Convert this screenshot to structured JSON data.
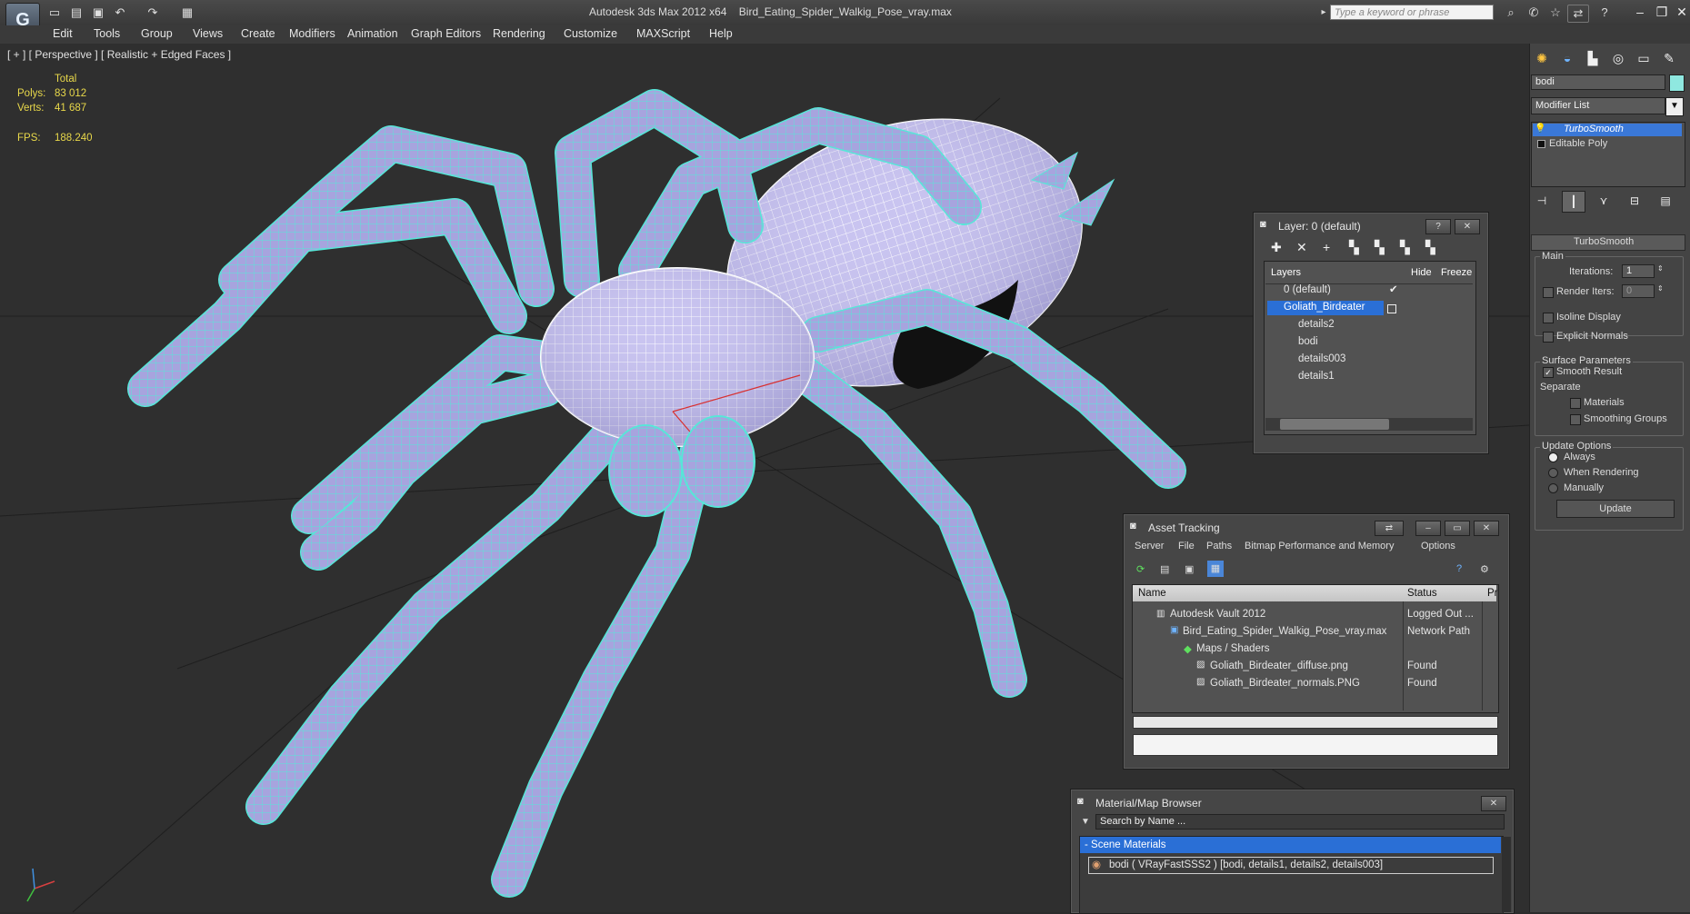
{
  "title": {
    "app": "Autodesk 3ds Max  2012 x64",
    "file": "Bird_Eating_Spider_Walkig_Pose_vray.max",
    "search_placeholder": "Type a keyword or phrase"
  },
  "menu": [
    "Edit",
    "Tools",
    "Group",
    "Views",
    "Create",
    "Modifiers",
    "Animation",
    "Graph Editors",
    "Rendering",
    "Customize",
    "MAXScript",
    "Help"
  ],
  "viewport": {
    "label": "[ + ] [ Perspective ] [ Realistic + Edged Faces ]",
    "stats": {
      "total_label": "Total",
      "polys_label": "Polys:",
      "polys_value": "83 012",
      "verts_label": "Verts:",
      "verts_value": "41 687",
      "fps_label": "FPS:",
      "fps_value": "188.240"
    }
  },
  "command_panel": {
    "object_name": "bodi",
    "modifier_list": "Modifier List",
    "stack": [
      "TurboSmooth",
      "Editable Poly"
    ],
    "rollout_title": "TurboSmooth",
    "main_group": "Main",
    "iterations_label": "Iterations:",
    "iterations_value": "1",
    "render_iters_label": "Render Iters:",
    "render_iters_value": "0",
    "isoline": "Isoline Display",
    "explicit_normals": "Explicit Normals",
    "surface_group": "Surface Parameters",
    "smooth_result": "Smooth Result",
    "separate": "Separate",
    "materials": "Materials",
    "smoothing_groups": "Smoothing Groups",
    "update_group": "Update Options",
    "always": "Always",
    "when_rendering": "When Rendering",
    "manually": "Manually",
    "update_button": "Update"
  },
  "layer_dialog": {
    "title": "Layer: 0 (default)",
    "columns": [
      "Layers",
      "Hide",
      "Freeze"
    ],
    "rows": [
      "0 (default)",
      "Goliath_Birdeater",
      "details2",
      "bodi",
      "details003",
      "details1"
    ]
  },
  "asset_dialog": {
    "title": "Asset Tracking",
    "menu": [
      "Server",
      "File",
      "Paths",
      "Bitmap Performance and Memory",
      "Options"
    ],
    "columns": [
      "Name",
      "Status",
      "Pr"
    ],
    "rows": [
      {
        "name": "Autodesk Vault 2012",
        "status": "Logged Out ..."
      },
      {
        "name": "Bird_Eating_Spider_Walkig_Pose_vray.max",
        "status": "Network Path"
      },
      {
        "name": "Maps / Shaders",
        "status": ""
      },
      {
        "name": "Goliath_Birdeater_diffuse.png",
        "status": "Found"
      },
      {
        "name": "Goliath_Birdeater_normals.PNG",
        "status": "Found"
      }
    ]
  },
  "material_dialog": {
    "title": "Material/Map Browser",
    "search_placeholder": "Search by Name ...",
    "section": "- Scene Materials",
    "item": "bodi  ( VRayFastSSS2 ) [bodi, details1, details2, details003]"
  },
  "colors": {
    "wire": "#57e6d8",
    "body": "#a9a6e0",
    "selection": "#2a6fd6"
  }
}
